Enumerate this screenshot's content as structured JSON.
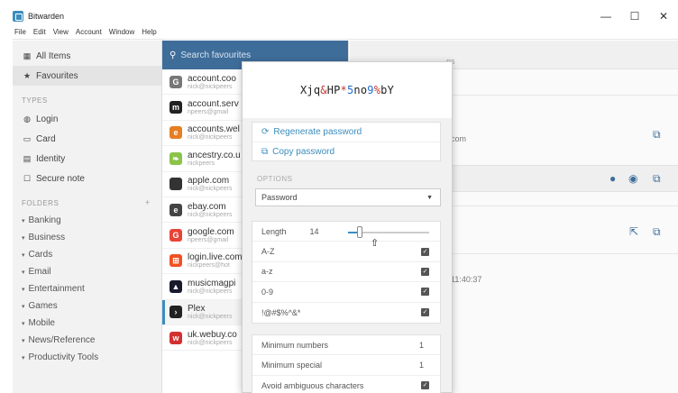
{
  "window": {
    "title": "Bitwarden",
    "controls": {
      "minimize": "—",
      "maximize": "☐",
      "close": "✕"
    }
  },
  "menu": [
    "File",
    "Edit",
    "View",
    "Account",
    "Window",
    "Help"
  ],
  "nav": {
    "all_items": "All Items",
    "favourites": "Favourites",
    "types_heading": "TYPES",
    "types": [
      "Login",
      "Card",
      "Identity",
      "Secure note"
    ],
    "folders_heading": "FOLDERS",
    "folders_add": "+",
    "folders": [
      "Banking",
      "Business",
      "Cards",
      "Email",
      "Entertainment",
      "Games",
      "Mobile",
      "News/Reference",
      "Productivity Tools"
    ]
  },
  "list": {
    "search_placeholder": "Search favourites",
    "items": [
      {
        "title": "account.coo",
        "sub": "nick@nickpeers",
        "icon": "G",
        "color": "#777777"
      },
      {
        "title": "account.serv",
        "sub": "npeers@gmail",
        "icon": "m",
        "color": "#222222"
      },
      {
        "title": "accounts.wel",
        "sub": "nick@nickpeers",
        "icon": "e",
        "color": "#e67e22"
      },
      {
        "title": "ancestry.co.u",
        "sub": "nickpeers",
        "icon": "❧",
        "color": "#8bc34a"
      },
      {
        "title": "apple.com",
        "sub": "nick@nickpeers",
        "icon": "",
        "color": "#333333"
      },
      {
        "title": "ebay.com",
        "sub": "nick@nickpeers",
        "icon": "e",
        "color": "#444444"
      },
      {
        "title": "google.com",
        "sub": "npeers@gmail",
        "icon": "G",
        "color": "#ea4335"
      },
      {
        "title": "login.live.com",
        "sub": "nickpeers@hot",
        "icon": "⊞",
        "color": "#f25022"
      },
      {
        "title": "musicmagpi",
        "sub": "nick@nickpeers",
        "icon": "▲",
        "color": "#1a1a2e"
      },
      {
        "title": "Plex",
        "sub": "nick@nickpeers",
        "icon": "›",
        "color": "#222222"
      },
      {
        "title": "uk.webuy.co",
        "sub": "nick@nickpeers",
        "icon": "w",
        "color": "#d32f2f"
      }
    ]
  },
  "detail": {
    "header_partial": "ns",
    "url_partial": "com",
    "timestamp_partial": "11:40:37"
  },
  "generator": {
    "password": {
      "p1": "Xjq",
      "s1": "&",
      "p2": "HP",
      "s2": "*",
      "n1": "5",
      "p3": "no",
      "n2": "9",
      "s3": "%",
      "p4": "bY"
    },
    "regenerate_label": "Regenerate password",
    "copy_label": "Copy password",
    "options_label": "OPTIONS",
    "type_value": "Password",
    "length_label": "Length",
    "length_value": "14",
    "length_slider_fraction": 0.14,
    "upper_label": "A-Z",
    "lower_label": "a-z",
    "digits_label": "0-9",
    "special_label": "!@#$%^&*",
    "min_numbers_label": "Minimum numbers",
    "min_numbers_value": "1",
    "min_special_label": "Minimum special",
    "min_special_value": "1",
    "avoid_ambiguous_label": "Avoid ambiguous characters"
  }
}
